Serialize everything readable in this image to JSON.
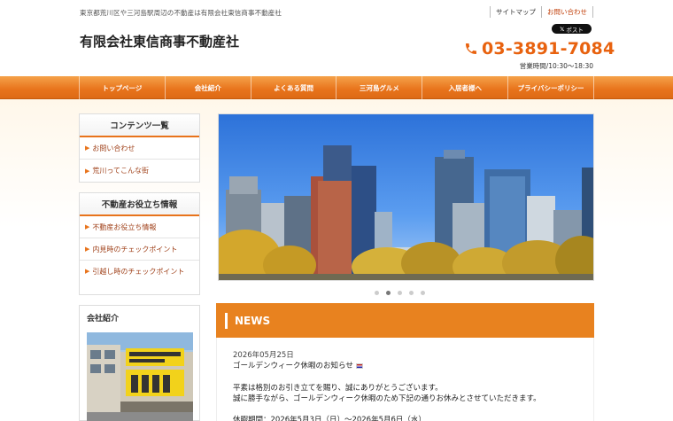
{
  "header": {
    "tagline": "東京都荒川区や三河島駅周辺の不動産は有限会社東信商事不動産社",
    "title": "有限会社東信商事不動産社",
    "links": [
      "サイトマップ",
      "お問い合わせ"
    ],
    "post_button": "ポスト",
    "phone": "03-3891-7084",
    "hours": "営業時間/10:30〜18:30"
  },
  "nav": {
    "items": [
      "トップページ",
      "会社紹介",
      "よくある質問",
      "三河島グルメ",
      "入居者様へ",
      "プライバシーポリシー"
    ]
  },
  "sidebar": {
    "contents": {
      "heading": "コンテンツ一覧",
      "items": [
        "お問い合わせ",
        "荒川ってこんな街"
      ]
    },
    "tips": {
      "heading": "不動産お役立ち情報",
      "items": [
        "不動産お役立ち情報",
        "内見時のチェックポイント",
        "引越し時のチェックポイント"
      ]
    },
    "company": {
      "heading": "会社紹介"
    }
  },
  "slider": {
    "dot_count": 5,
    "active_index": 1
  },
  "news": {
    "heading": "NEWS",
    "date": "2026年05月25日",
    "subject": "ゴールデンウィーク休暇のお知らせ",
    "line1": "平素は格別のお引き立てを賜り、誠にありがとうございます。",
    "line2": "誠に勝手ながら、ゴールデンウィーク休暇のため下記の通りお休みとさせていただきます。",
    "line3": "休暇期間：2026年5月3日（日）～2026年5月6日（水）"
  },
  "colors": {
    "accent": "#e8731b",
    "phone": "#e8620f",
    "news_bar": "#e8821f"
  }
}
